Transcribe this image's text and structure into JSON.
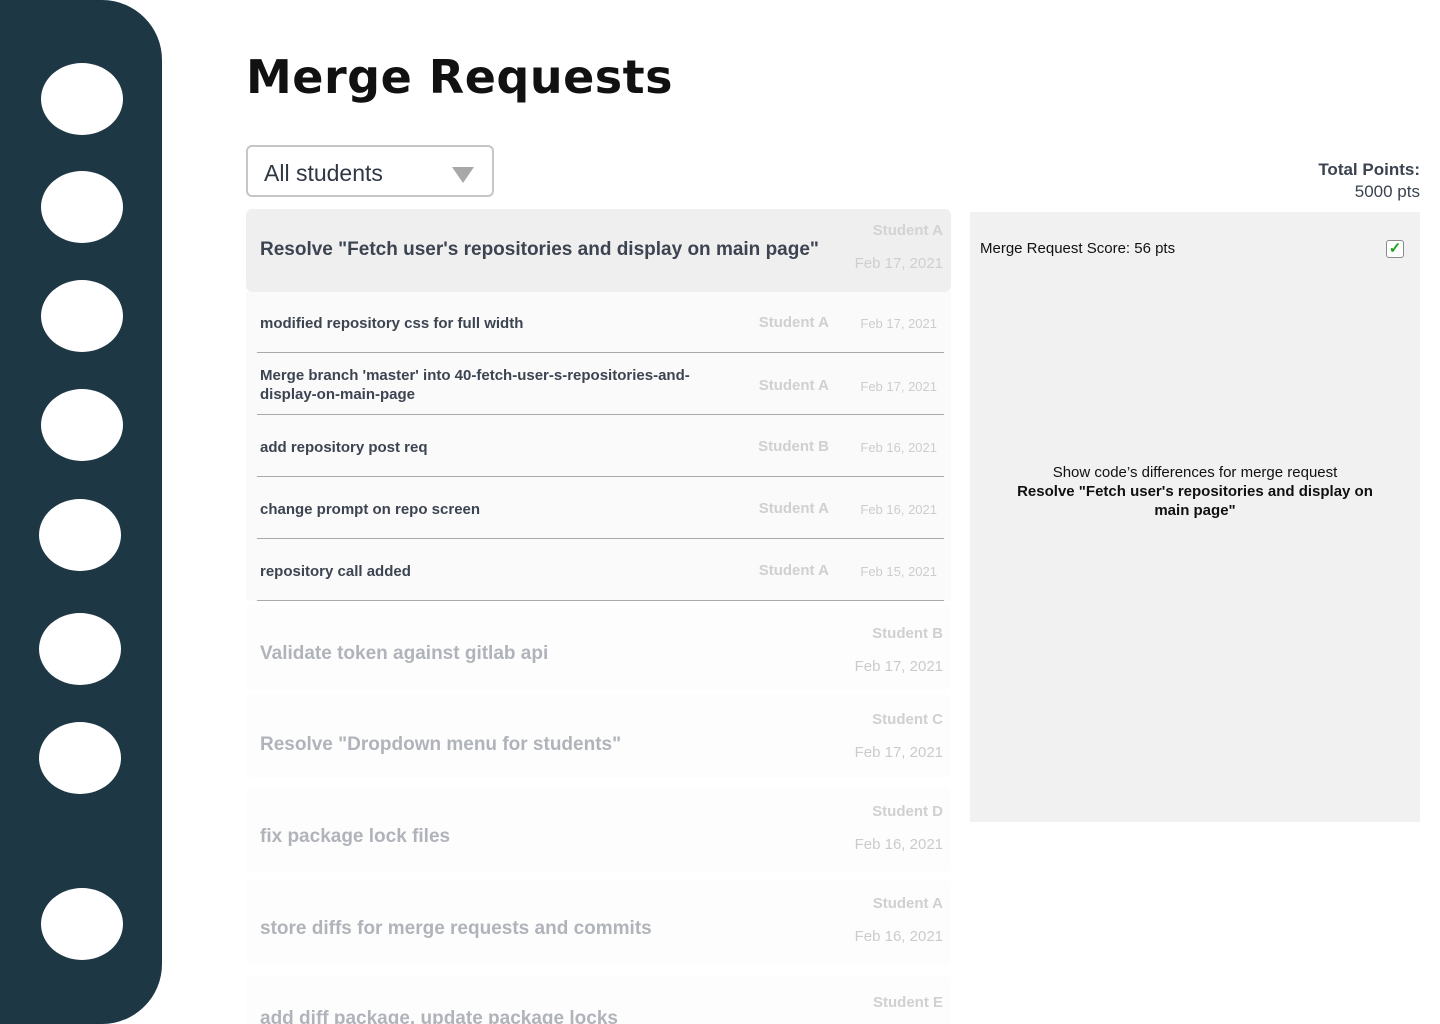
{
  "page": {
    "title": "Merge Requests"
  },
  "filter": {
    "selected": "All students"
  },
  "total_points": {
    "label": "Total Points:",
    "value": "5000 pts"
  },
  "selected_merge_request": {
    "title": "Resolve \"Fetch user's repositories and display on main page\"",
    "student": "Student A",
    "date": "Feb 17, 2021",
    "commits": [
      {
        "title": "modified repository css for full width",
        "student": "Student A",
        "date": "Feb 17, 2021"
      },
      {
        "title": "Merge branch 'master' into 40-fetch-user-s-repositories-and-display-on-main-page",
        "student": "Student A",
        "date": "Feb 17, 2021"
      },
      {
        "title": "add repository post req",
        "student": "Student B",
        "date": "Feb 16, 2021"
      },
      {
        "title": "change prompt on repo screen",
        "student": "Student A",
        "date": "Feb 16, 2021"
      },
      {
        "title": "repository call added",
        "student": "Student A",
        "date": "Feb 15, 2021"
      }
    ]
  },
  "merge_requests": [
    {
      "title": "Validate token against gitlab api",
      "student": "Student B",
      "date": "Feb 17, 2021"
    },
    {
      "title": "Resolve \"Dropdown menu for students\"",
      "student": "Student C",
      "date": "Feb 17, 2021"
    },
    {
      "title": "fix package lock files",
      "student": "Student D",
      "date": "Feb 16, 2021"
    },
    {
      "title": "store diffs for merge requests and commits",
      "student": "Student A",
      "date": "Feb 16, 2021"
    },
    {
      "title": "add diff package, update package locks",
      "student": "Student E",
      "date": ""
    }
  ],
  "diff_panel": {
    "score": "Merge Request Score: 56 pts",
    "checked": true,
    "check_glyph": "✓",
    "message": "Show code’s differences for merge request",
    "mr_title": "Resolve \"Fetch user's repositories and display on main page\""
  },
  "sidebar": {
    "icons": [
      "nav-icon-1",
      "nav-icon-2",
      "nav-icon-3",
      "nav-icon-4",
      "nav-icon-5",
      "nav-icon-6",
      "nav-icon-7",
      "nav-icon-8"
    ]
  },
  "colors": {
    "sidebar": "#1e3744",
    "panel": "#f1f1f1",
    "check": "#1aa31a"
  }
}
